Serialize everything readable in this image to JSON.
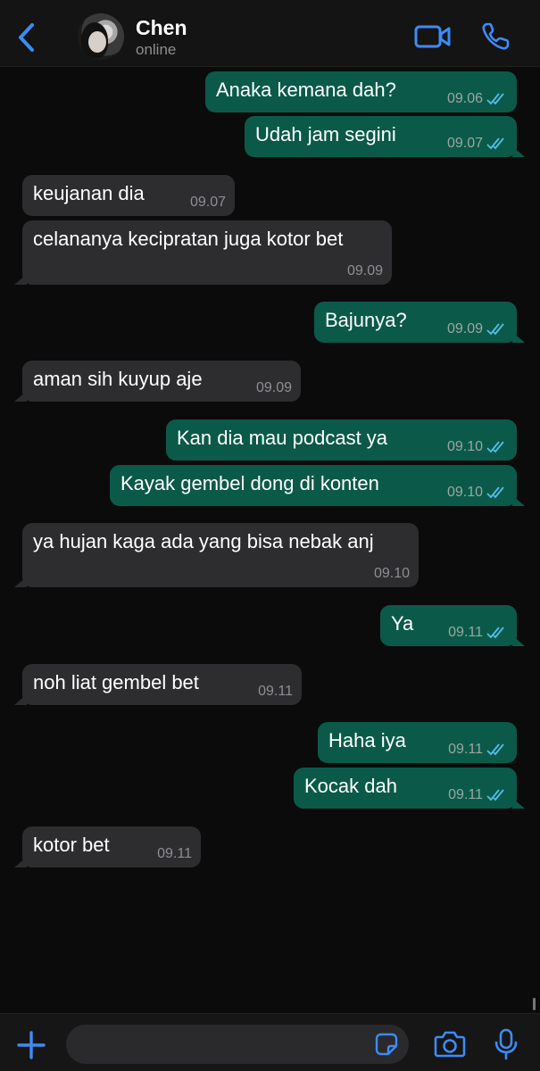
{
  "header": {
    "contact_name": "Chen",
    "status": "online",
    "icons": [
      "back-chevron-icon",
      "video-call-icon",
      "phone-icon"
    ]
  },
  "colors": {
    "accent": "#3c8cf6",
    "outgoing_bubble": "#0b5a49",
    "incoming_bubble": "#2d2d2f",
    "read_ticks": "#53bdeb",
    "background": "#0b0b0b"
  },
  "messages": [
    {
      "direction": "out",
      "text": "Anaka kemana dah?",
      "time": "09.06",
      "read": true
    },
    {
      "direction": "out",
      "text": "Udah jam segini",
      "time": "09.07",
      "read": true
    },
    {
      "direction": "in",
      "text": "keujanan dia",
      "time": "09.07"
    },
    {
      "direction": "in",
      "text": "celananya kecipratan juga kotor bet",
      "time": "09.09"
    },
    {
      "direction": "out",
      "text": "Bajunya?",
      "time": "09.09",
      "read": true
    },
    {
      "direction": "in",
      "text": "aman sih kuyup aje",
      "time": "09.09"
    },
    {
      "direction": "out",
      "text": "Kan dia mau podcast ya",
      "time": "09.10",
      "read": true
    },
    {
      "direction": "out",
      "text": "Kayak gembel dong di konten",
      "time": "09.10",
      "read": true
    },
    {
      "direction": "in",
      "text": "ya hujan kaga ada yang bisa nebak anj",
      "time": "09.10"
    },
    {
      "direction": "out",
      "text": "Ya",
      "time": "09.11",
      "read": true
    },
    {
      "direction": "in",
      "text": "noh liat gembel bet",
      "time": "09.11"
    },
    {
      "direction": "out",
      "text": "Haha iya",
      "time": "09.11",
      "read": true
    },
    {
      "direction": "out",
      "text": "Kocak dah",
      "time": "09.11",
      "read": true
    },
    {
      "direction": "in",
      "text": "kotor bet",
      "time": "09.11"
    }
  ],
  "composer": {
    "input_value": "",
    "icons": [
      "plus-icon",
      "sticker-icon",
      "camera-icon",
      "microphone-icon"
    ]
  }
}
